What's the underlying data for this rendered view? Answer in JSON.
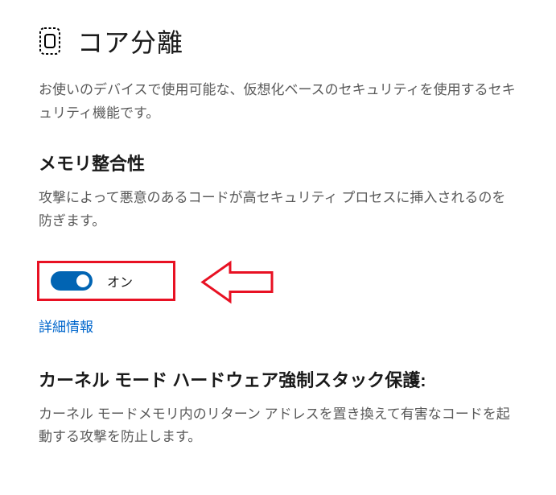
{
  "page": {
    "title": "コア分離",
    "description": "お使いのデバイスで使用可能な、仮想化ベースのセキュリティを使用するセキュリティ機能です。"
  },
  "memory_integrity": {
    "heading": "メモリ整合性",
    "description": "攻撃によって悪意のあるコードが高セキュリティ プロセスに挿入されるのを防ぎます。",
    "toggle_state": "on",
    "toggle_label": "オン",
    "more_info_link": "詳細情報"
  },
  "kernel_mode": {
    "heading": "カーネル モード ハードウェア強制スタック保護:",
    "description": "カーネル モードメモリ内のリターン アドレスを置き換えて有害なコードを起動する攻撃を防止します。"
  },
  "annotation": {
    "highlight_color": "#e81123"
  }
}
